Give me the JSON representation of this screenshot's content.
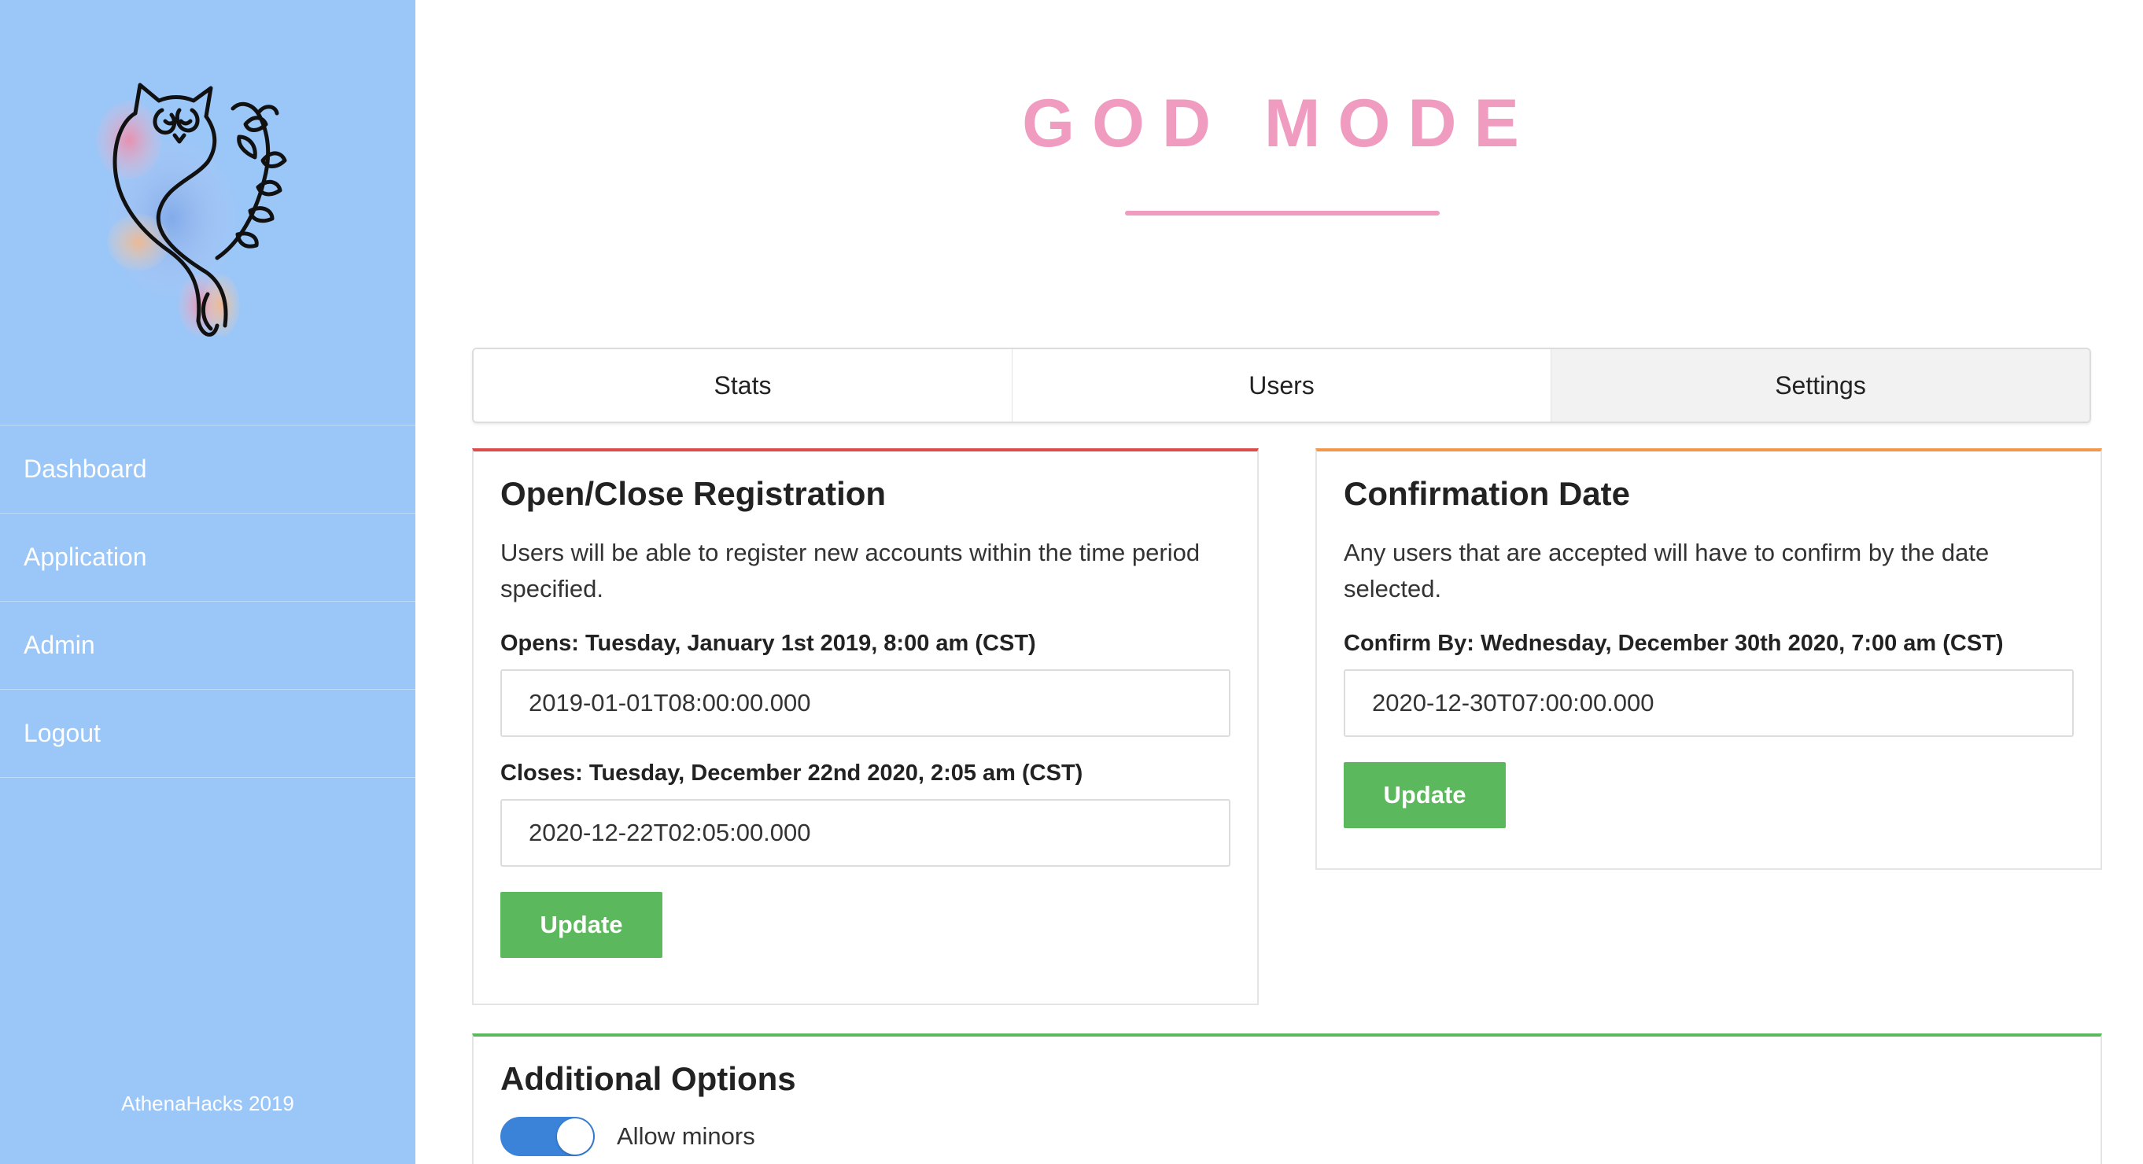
{
  "app": {
    "title": "GOD MODE"
  },
  "sidebar": {
    "logo_icon": "owl-logo-icon",
    "items": [
      {
        "label": "Dashboard"
      },
      {
        "label": "Application"
      },
      {
        "label": "Admin"
      },
      {
        "label": "Logout"
      }
    ],
    "footer": "AthenaHacks 2019"
  },
  "tabs": [
    {
      "label": "Stats",
      "active": false
    },
    {
      "label": "Users",
      "active": false
    },
    {
      "label": "Settings",
      "active": true
    }
  ],
  "registration": {
    "title": "Open/Close Registration",
    "description": "Users will be able to register new accounts within the time period specified.",
    "opens_label": "Opens: Tuesday, January 1st 2019, 8:00 am (CST)",
    "opens_value": "2019-01-01T08:00:00.000",
    "closes_label": "Closes: Tuesday, December 22nd 2020, 2:05 am (CST)",
    "closes_value": "2020-12-22T02:05:00.000",
    "update_label": "Update"
  },
  "confirmation": {
    "title": "Confirmation Date",
    "description": "Any users that are accepted will have to confirm by the date selected.",
    "confirm_label": "Confirm By: Wednesday, December 30th 2020, 7:00 am (CST)",
    "confirm_value": "2020-12-30T07:00:00.000",
    "update_label": "Update"
  },
  "additional": {
    "title": "Additional Options",
    "allow_minors_label": "Allow minors",
    "allow_minors_on": true
  },
  "colors": {
    "sidebar": "#9ac6f8",
    "title_pink": "#ef9cc0",
    "button_green": "#5cb85c",
    "toggle_blue": "#3a83d9",
    "card_red": "#dd4b4b",
    "card_orange": "#f0994e",
    "card_green": "#5cb85c"
  }
}
